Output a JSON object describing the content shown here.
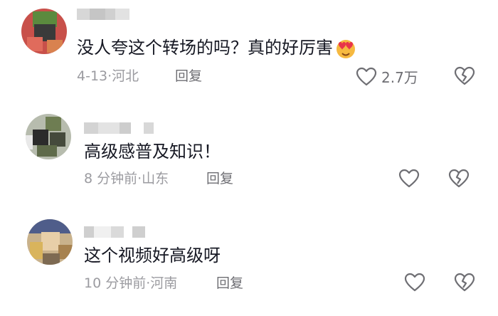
{
  "comments": [
    {
      "text": "没人夸这个转场的吗？真的好厉害",
      "emoji": "smiling-face-with-heart-eyes",
      "meta": "4-13·河北",
      "reply": "回复",
      "likes": "2.7万"
    },
    {
      "text": "高级感普及知识！",
      "meta": "8 分钟前·山东",
      "reply": "回复",
      "likes": ""
    },
    {
      "text": "这个视频好高级呀",
      "meta": "10 分钟前·河南",
      "reply": "回复",
      "likes": ""
    }
  ],
  "colors": {
    "text": "#161823",
    "meta": "#9b9ba0",
    "icon": "#6e6e73"
  }
}
